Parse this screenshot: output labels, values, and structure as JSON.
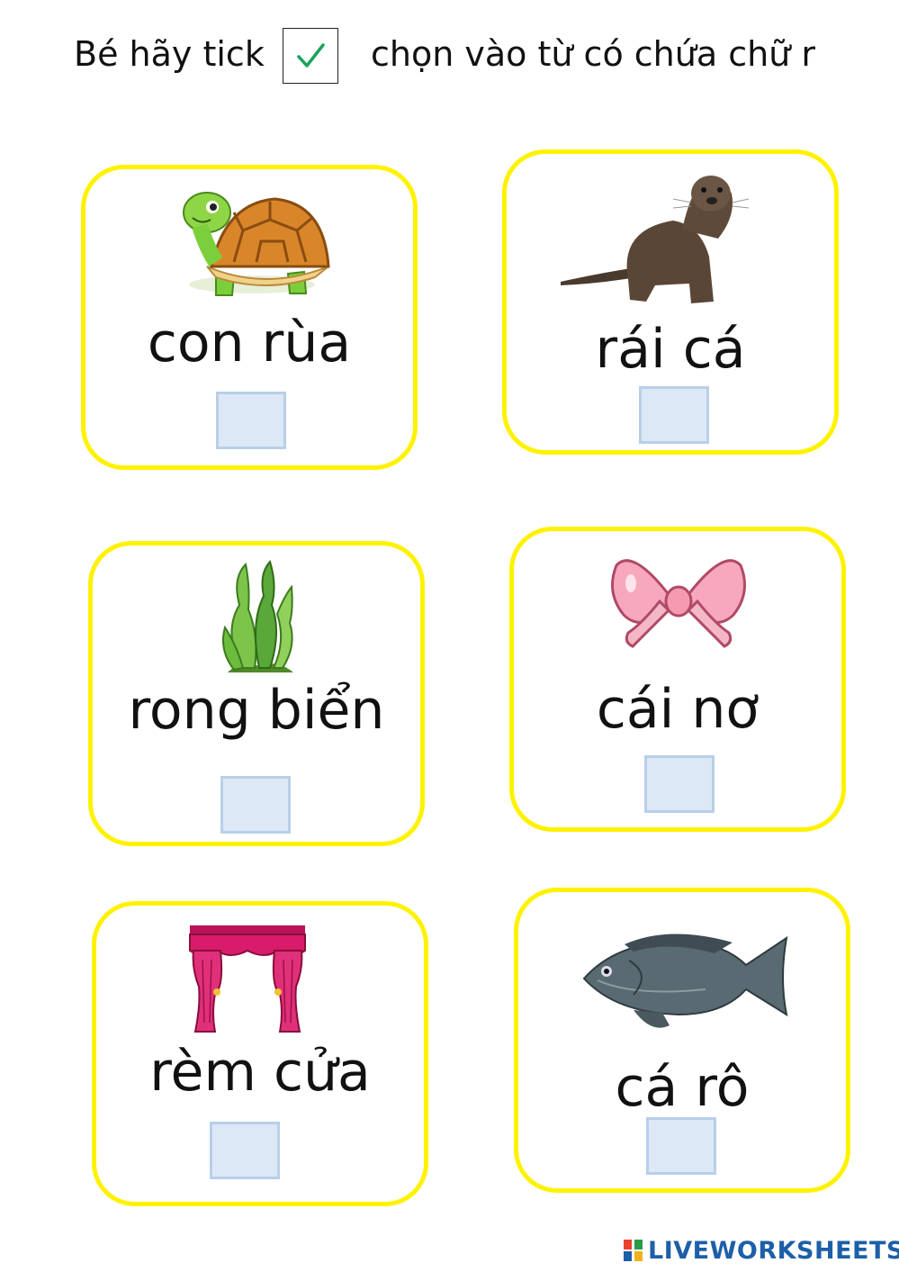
{
  "instruction": {
    "before": "Bé hãy tick",
    "after": "chọn vào từ có chứa chữ r"
  },
  "cards": [
    {
      "word": "con rùa",
      "icon": "turtle-icon"
    },
    {
      "word": "rái cá",
      "icon": "otter-icon"
    },
    {
      "word": "rong biển",
      "icon": "seaweed-icon"
    },
    {
      "word": "cái nơ",
      "icon": "bow-icon"
    },
    {
      "word": "rèm cửa",
      "icon": "curtain-icon"
    },
    {
      "word": "cá rô",
      "icon": "fish-icon"
    }
  ],
  "colors": {
    "card_border": "#fff200",
    "answer_box_fill": "#dce8f6",
    "tick": "#1aa35a",
    "brand": "#1d5fa8"
  },
  "brand": "LIVEWORKSHEETS"
}
